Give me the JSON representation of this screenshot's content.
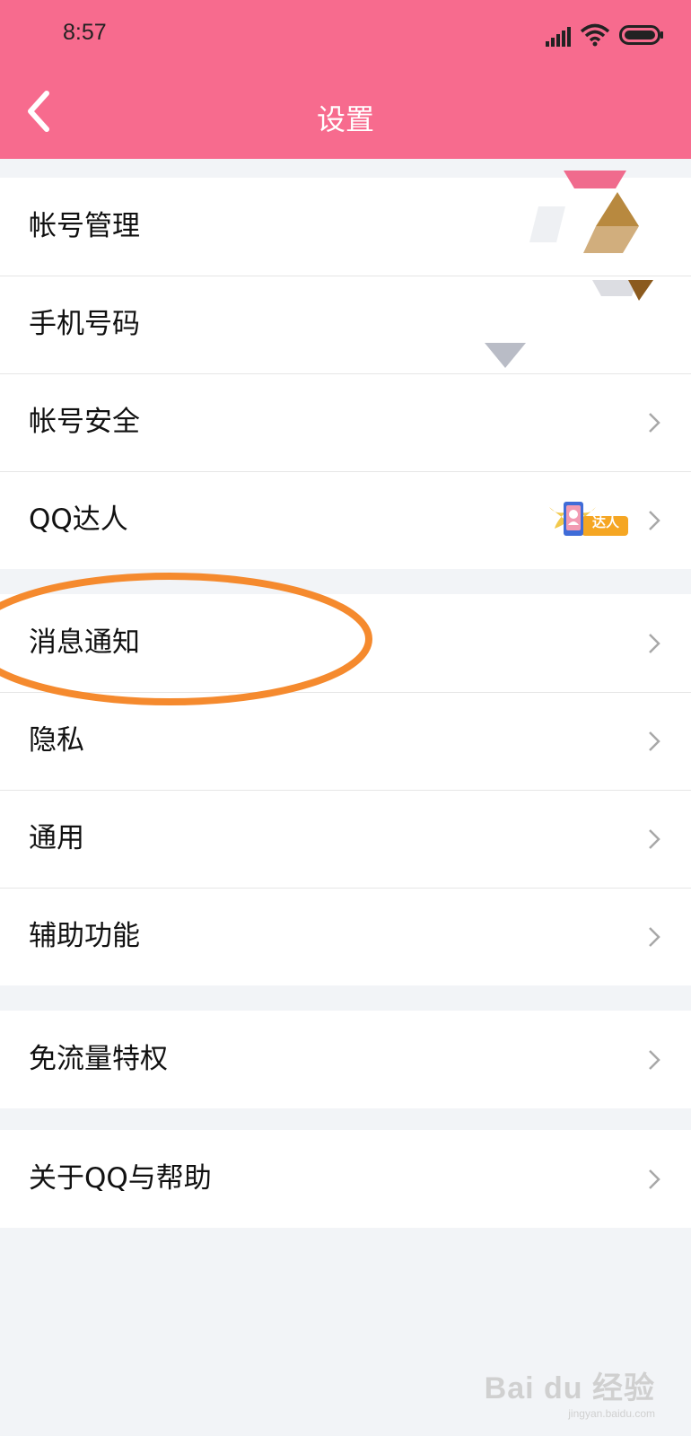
{
  "status_bar": {
    "time": "8:57",
    "icons": [
      "signal-icon",
      "wifi-icon",
      "battery-icon"
    ]
  },
  "header": {
    "title": "设置",
    "back_icon": "chevron-left-icon",
    "background_color": "#f76b8e"
  },
  "groups": [
    {
      "items": [
        {
          "label": "帐号管理"
        },
        {
          "label": "手机号码"
        },
        {
          "label": "帐号安全"
        },
        {
          "label": "QQ达人",
          "badge": {
            "text": "达人",
            "icon": "qq-daren-badge-icon"
          }
        }
      ]
    },
    {
      "items": [
        {
          "label": "消息通知"
        },
        {
          "label": "隐私"
        },
        {
          "label": "通用"
        },
        {
          "label": "辅助功能"
        }
      ]
    },
    {
      "items": [
        {
          "label": "免流量特权"
        }
      ]
    },
    {
      "items": [
        {
          "label": "关于QQ与帮助"
        }
      ]
    }
  ],
  "annotation": {
    "color": "#f58a2e"
  },
  "watermark": {
    "logo": "Bai du 经验",
    "url": "jingyan.baidu.com"
  }
}
